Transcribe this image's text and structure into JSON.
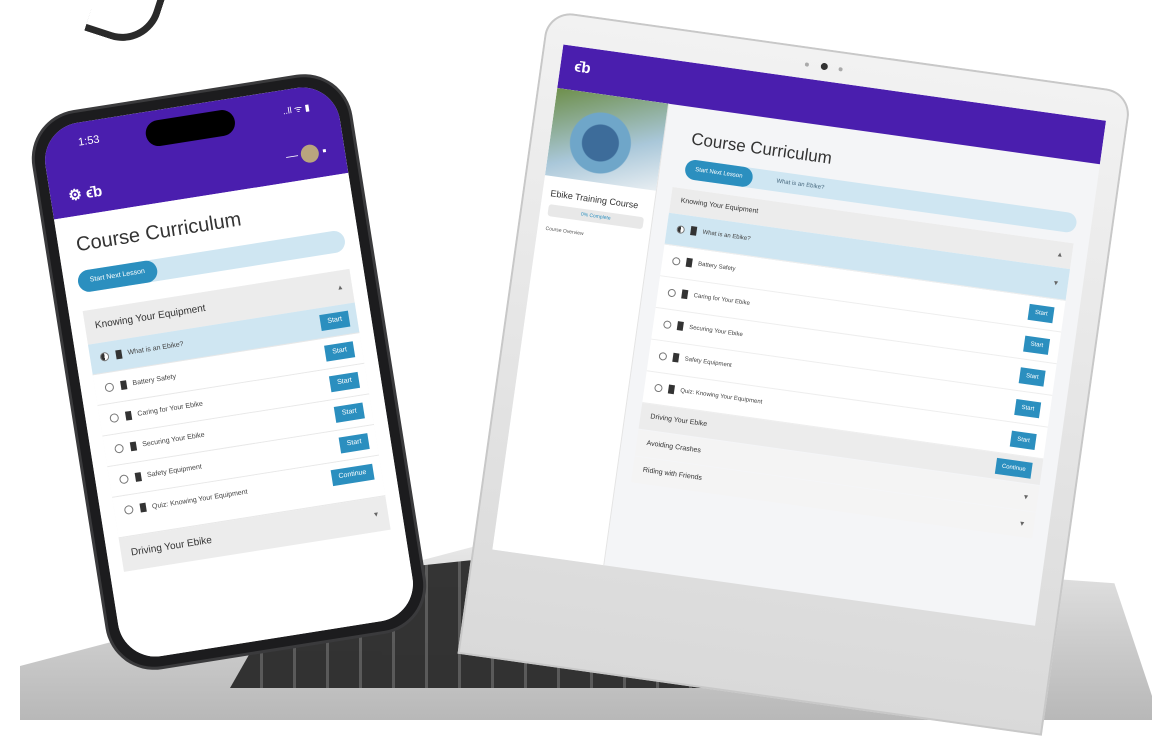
{
  "brand": {
    "logo_text": "ϵ̄b",
    "primary": "#4a1eae",
    "accent": "#2b8fbf",
    "pill_bg": "#cfe6f2"
  },
  "laptop": {
    "course_title": "Ebike Training Course",
    "progress_text": "0% Complete",
    "side_link": "Course Overview",
    "heading": "Course Curriculum",
    "start_button": "Start Next Lesson",
    "next_lesson": "What is an Ebike?",
    "sections": [
      {
        "title": "Knowing Your Equipment",
        "lessons": [
          {
            "label": "What is an Ebike?",
            "button": "Start",
            "active": true
          },
          {
            "label": "Battery Safety",
            "button": "Start"
          },
          {
            "label": "Caring for Your Ebike",
            "button": "Start"
          },
          {
            "label": "Securing Your Ebike",
            "button": "Start"
          },
          {
            "label": "Safety Equipment",
            "button": "Start"
          },
          {
            "label": "Quiz: Knowing Your Equipment",
            "button": "Start"
          }
        ]
      },
      {
        "title": "Driving Your Ebike",
        "button": "Continue"
      },
      {
        "title": "Avoiding Crashes"
      },
      {
        "title": "Riding with Friends"
      }
    ]
  },
  "phone": {
    "time": "1:53",
    "status_icons": "..ll ᯤ ▮",
    "heading": "Course Curriculum",
    "start_button": "Start Next Lesson",
    "sections": [
      {
        "title": "Knowing Your Equipment",
        "lessons": [
          {
            "label": "What is an Ebike?",
            "button": "Start",
            "active": true
          },
          {
            "label": "Battery Safety",
            "button": "Start"
          },
          {
            "label": "Caring for Your Ebike",
            "button": "Start"
          },
          {
            "label": "Securing Your Ebike",
            "button": "Start"
          },
          {
            "label": "Safety Equipment",
            "button": "Start"
          },
          {
            "label": "Quiz: Knowing Your Equipment",
            "button": "Continue"
          }
        ]
      },
      {
        "title": "Driving Your Ebike"
      }
    ]
  },
  "icons": [
    "gear-icon",
    "avatar",
    "menu-icon",
    "chevron-down-icon",
    "progress-circle-icon",
    "document-icon"
  ]
}
